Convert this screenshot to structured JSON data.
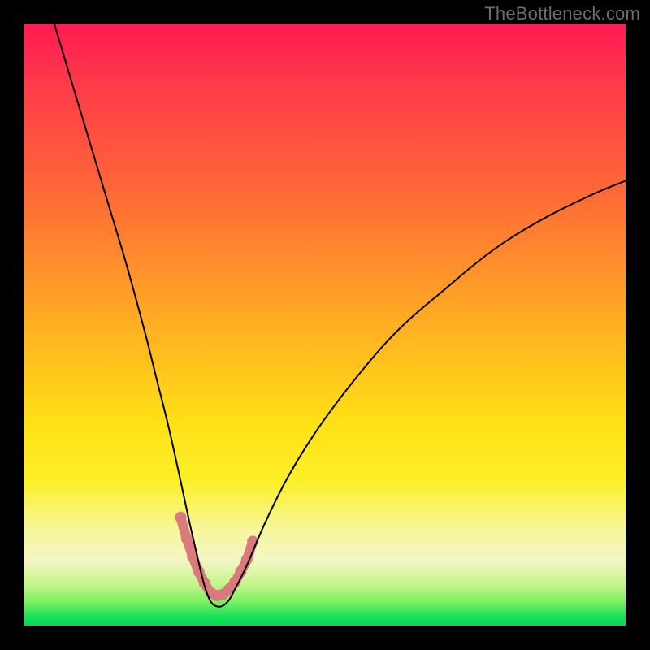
{
  "attribution": "TheBottleneck.com",
  "chart_data": {
    "type": "line",
    "title": "",
    "xlabel": "",
    "ylabel": "",
    "xlim": [
      0,
      100
    ],
    "ylim": [
      0,
      100
    ],
    "grid": false,
    "legend": false,
    "series": [
      {
        "name": "bottleneck-curve",
        "color": "#000000",
        "stroke_width": 2,
        "x": [
          5,
          8,
          11,
          14,
          17,
          20,
          22,
          24,
          26,
          27.5,
          29,
          30,
          31,
          32,
          33,
          34,
          35,
          37,
          40,
          44,
          49,
          55,
          62,
          70,
          78,
          86,
          94,
          100
        ],
        "y": [
          100,
          90,
          80,
          70,
          60,
          49,
          41,
          33,
          24,
          17,
          10.5,
          6.5,
          4,
          3.2,
          3.3,
          4.2,
          6,
          10,
          17,
          25,
          33,
          41,
          49,
          56,
          62.5,
          67.5,
          71.5,
          74
        ]
      },
      {
        "name": "highlight-band",
        "color": "#d97a7d",
        "stroke_width": 12,
        "x": [
          26,
          27,
          28,
          29,
          30,
          31,
          32,
          33,
          34,
          35,
          36,
          37,
          38
        ],
        "y": [
          18,
          14.5,
          11.5,
          9,
          7,
          5.5,
          5,
          5.2,
          6,
          7.2,
          9,
          11,
          14
        ]
      }
    ],
    "gradient_stops": [
      {
        "pos": 0.0,
        "color": "#ff1a52"
      },
      {
        "pos": 0.26,
        "color": "#ff6338"
      },
      {
        "pos": 0.53,
        "color": "#ffb81f"
      },
      {
        "pos": 0.76,
        "color": "#fdf028"
      },
      {
        "pos": 0.89,
        "color": "#f4f6c6"
      },
      {
        "pos": 0.96,
        "color": "#7fef63"
      },
      {
        "pos": 1.0,
        "color": "#06d653"
      }
    ]
  }
}
